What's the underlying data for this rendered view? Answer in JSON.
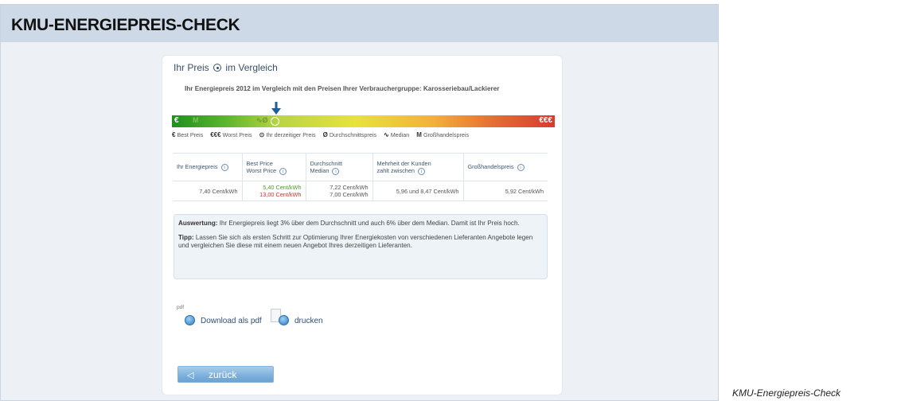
{
  "header": {
    "title": "KMU-ENERGIEPREIS-CHECK"
  },
  "panel": {
    "title_part1": "Ihr Preis",
    "title_part2": "im Vergleich",
    "subtitle": "Ihr Energiepreis 2012 im Vergleich mit den Preisen Ihrer Verbrauchergruppe: Karosseriebau/Lackierer"
  },
  "scale": {
    "left_symbol": "€",
    "right_symbol": "€€€",
    "marker_position_fraction": 0.27
  },
  "legend": [
    {
      "symbol": "€",
      "label": "Best Preis"
    },
    {
      "symbol": "€€€",
      "label": "Worst Preis"
    },
    {
      "symbol": "⊙",
      "label": "Ihr derzeitiger Preis"
    },
    {
      "symbol": "Ø",
      "label": "Durchschnittspreis"
    },
    {
      "symbol": "∿",
      "label": "Median"
    },
    {
      "symbol": "M",
      "label": "Großhandelspreis"
    }
  ],
  "table": {
    "headers": {
      "col1": "Ihr Energiepreis",
      "col2_line1": "Best Price",
      "col2_line2": "Worst Price",
      "col3_line1": "Durchschnitt",
      "col3_line2": "Median",
      "col4_line1": "Mehrheit der Kunden",
      "col4_line2": "zahlt zwischen",
      "col5": "Großhandelspreis"
    },
    "row": {
      "energy_price": "7,40 Cent/kWh",
      "best_price": "5,40 Cent/kWh",
      "worst_price": "13,00 Cent/kWh",
      "average": "7,22 Cent/kWh",
      "median": "7,00 Cent/kWh",
      "majority_range": "5,96 und 8,47 Cent/kWh",
      "wholesale": "5,92 Cent/kWh"
    }
  },
  "evaluation": {
    "label": "Auswertung:",
    "text": " Ihr Energiepreis liegt 3% über dem Durchschnitt und auch 6% über dem Median. Damit ist Ihr Preis hoch.",
    "tip_label": "Tipp:",
    "tip_text": " Lassen Sie sich als ersten Schritt zur Optimierung Ihrer Energiekosten von verschiedenen Lieferanten Angebote legen und vergleichen Sie diese mit einem neuen Angebot Ihres derzeitigen Lieferanten."
  },
  "downloads": {
    "pdf_tag": "pdf",
    "download_label": "Download als pdf",
    "print_label": "drucken"
  },
  "back_button": {
    "label": "zurück"
  },
  "caption": "KMU-Energiepreis-Check",
  "colors": {
    "header_bg": "#cdd9e7",
    "accent_blue": "#2d6ea8",
    "best_green": "#4b9b2c",
    "worst_red": "#c0392b"
  }
}
